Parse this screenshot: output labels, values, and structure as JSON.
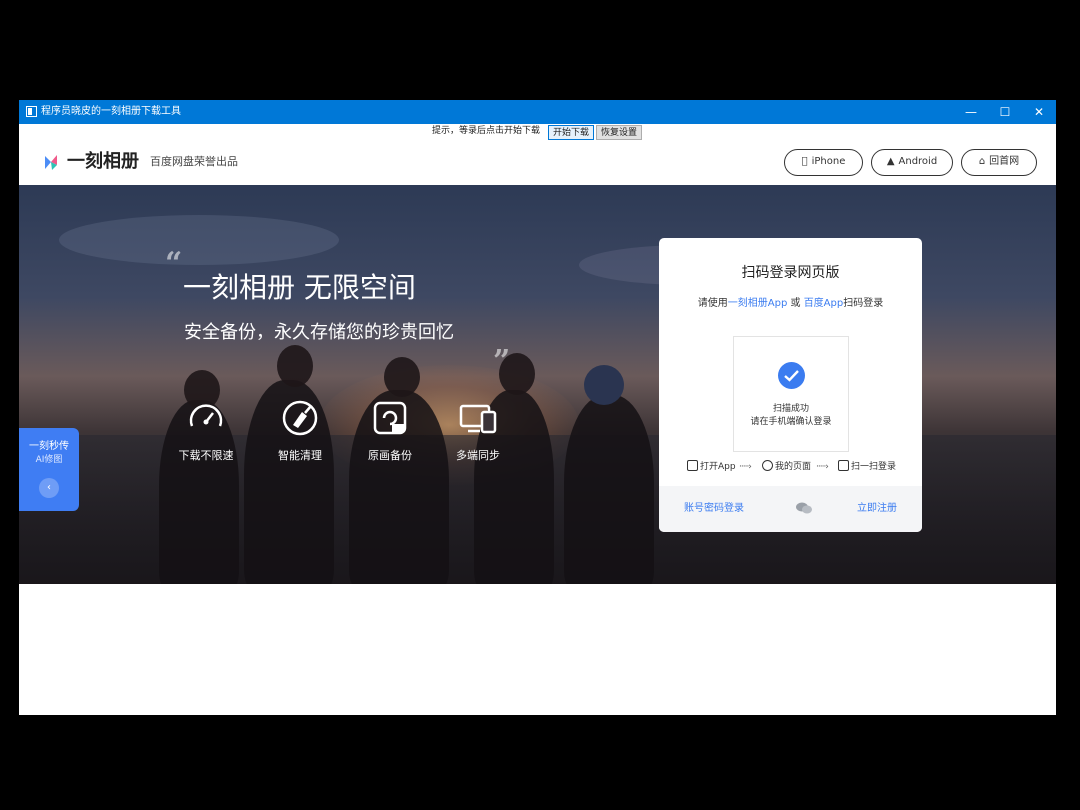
{
  "window": {
    "title": "程序员晓皮的一刻相册下载工具",
    "minimize_glyph": "—",
    "maximize_glyph": "☐",
    "close_glyph": "✕"
  },
  "toolbar": {
    "hint": "提示，等录后点击开始下载",
    "start_label": "开始下载",
    "settings_label": "恢复设置"
  },
  "header": {
    "brand": "一刻相册",
    "subtitle": "百度网盘荣誉出品",
    "buttons": [
      {
        "label": "iPhone",
        "icon": "apple-icon"
      },
      {
        "label": "Android",
        "icon": "android-icon"
      },
      {
        "label": "回首网",
        "icon": "home-icon"
      }
    ]
  },
  "hero": {
    "title": "一刻相册 无限空间",
    "subtitle": "安全备份，永久存储您的珍贵回忆",
    "features": [
      {
        "label": "下载不限速",
        "icon": "speedometer-icon"
      },
      {
        "label": "智能清理",
        "icon": "broom-icon"
      },
      {
        "label": "原画备份",
        "icon": "original-photo-icon"
      },
      {
        "label": "多端同步",
        "icon": "devices-sync-icon"
      }
    ]
  },
  "float_widget": {
    "line1": "一刻秒传",
    "line2": "AI修图",
    "button": "‹"
  },
  "login": {
    "title": "扫码登录网页版",
    "sub_prefix": "请使用",
    "app1": "一刻相册App",
    "sub_or": "或",
    "app2": "百度App",
    "sub_suffix": "扫码登录",
    "status1": "扫描成功",
    "status2": "请在手机端确认登录",
    "steps": [
      "打开App",
      "我的页面",
      "扫一扫登录"
    ],
    "account_login": "账号密码登录",
    "register": "立即注册"
  },
  "colors": {
    "titlebar": "#0078d7",
    "accent": "#3b7cf0"
  }
}
